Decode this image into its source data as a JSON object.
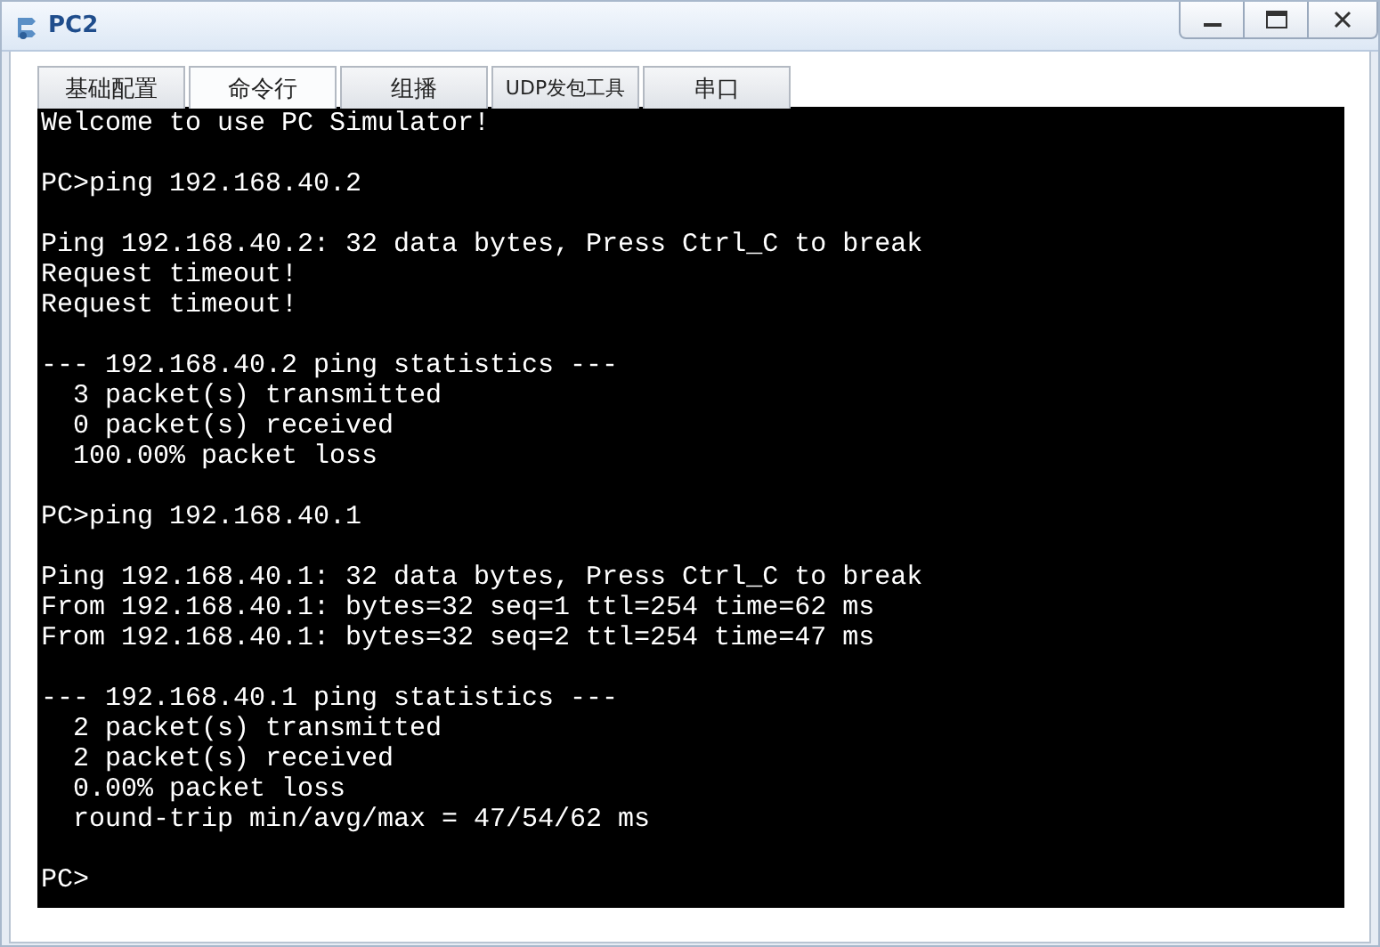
{
  "window": {
    "title": "PC2"
  },
  "tabs": [
    {
      "label": "基础配置",
      "selected": false
    },
    {
      "label": "命令行",
      "selected": true
    },
    {
      "label": "组播",
      "selected": false
    },
    {
      "label": "UDP发包工具",
      "selected": false
    },
    {
      "label": "串口",
      "selected": false
    }
  ],
  "terminal": {
    "blocks": [
      [
        "Welcome to use PC Simulator!"
      ],
      [
        "PC>ping 192.168.40.2"
      ],
      [
        "Ping 192.168.40.2: 32 data bytes, Press Ctrl_C to break",
        "Request timeout!",
        "Request timeout!"
      ],
      [
        "--- 192.168.40.2 ping statistics ---",
        "  3 packet(s) transmitted",
        "  0 packet(s) received",
        "  100.00% packet loss"
      ],
      [
        "PC>ping 192.168.40.1"
      ],
      [
        "Ping 192.168.40.1: 32 data bytes, Press Ctrl_C to break",
        "From 192.168.40.1: bytes=32 seq=1 ttl=254 time=62 ms",
        "From 192.168.40.1: bytes=32 seq=2 ttl=254 time=47 ms"
      ],
      [
        "--- 192.168.40.1 ping statistics ---",
        "  2 packet(s) transmitted",
        "  2 packet(s) received",
        "  0.00% packet loss",
        "  round-trip min/avg/max = 47/54/62 ms"
      ],
      [
        "PC>"
      ]
    ]
  }
}
